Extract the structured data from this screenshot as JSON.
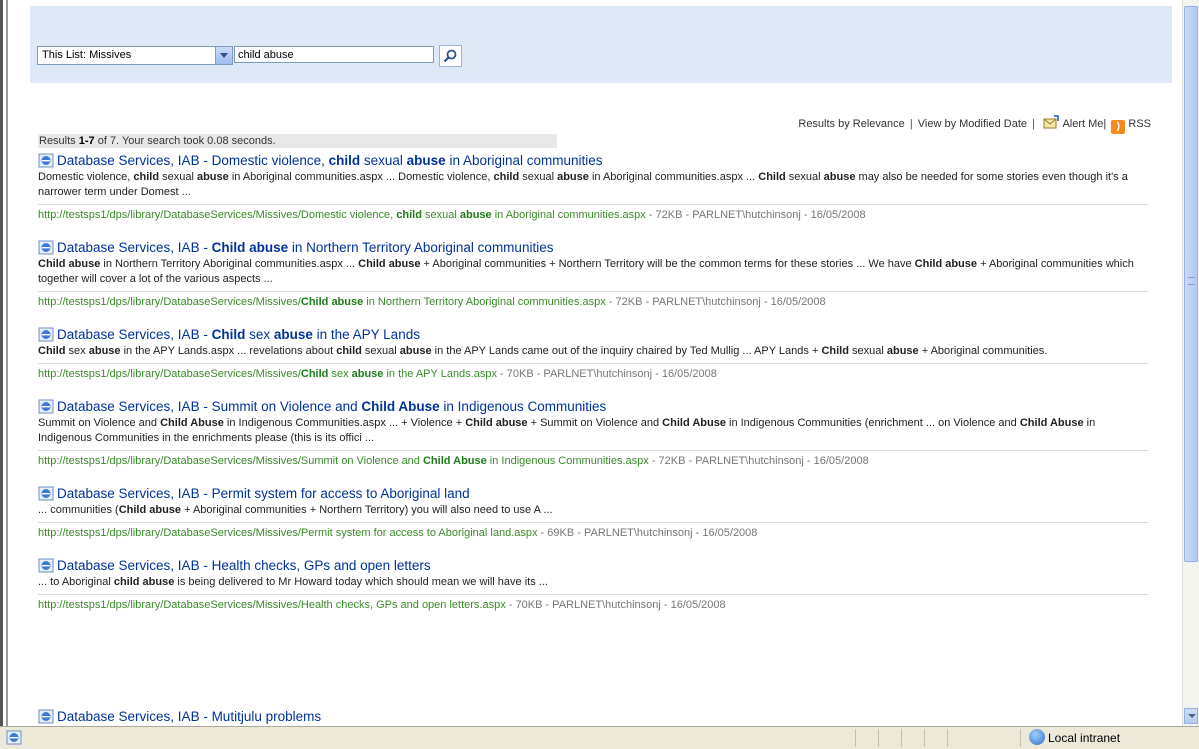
{
  "search": {
    "scope_label": "This List: Missives",
    "query": "child abuse"
  },
  "toolbar": {
    "by_relevance": "Results by Relevance",
    "separator": "|",
    "by_modified": "View by Modified Date",
    "alert_me": "Alert Me|",
    "rss": "RSS"
  },
  "stats": {
    "prefix": "Results ",
    "range": "1-7",
    "middle": " of 7. Your search took 0.08 seconds."
  },
  "results": [
    {
      "title_segments": [
        {
          "text": "Database Services, IAB - Domestic violence, ",
          "bold": false
        },
        {
          "text": "child",
          "bold": true
        },
        {
          "text": " sexual ",
          "bold": false
        },
        {
          "text": "abuse",
          "bold": true
        },
        {
          "text": " in Aboriginal communities",
          "bold": false
        }
      ],
      "snippet_segments": [
        {
          "text": "Domestic violence, ",
          "bold": false
        },
        {
          "text": "child",
          "bold": true
        },
        {
          "text": " sexual ",
          "bold": false
        },
        {
          "text": "abuse",
          "bold": true
        },
        {
          "text": " in Aboriginal communities.aspx ... Domestic violence, ",
          "bold": false
        },
        {
          "text": "child",
          "bold": true
        },
        {
          "text": " sexual ",
          "bold": false
        },
        {
          "text": "abuse",
          "bold": true
        },
        {
          "text": " in Aboriginal communities.aspx ... ",
          "bold": false
        },
        {
          "text": "Child",
          "bold": true
        },
        {
          "text": " sexual ",
          "bold": false
        },
        {
          "text": "abuse",
          "bold": true
        },
        {
          "text": " may also be needed for some stories even though it's a narrower term under Domest ...",
          "bold": false
        }
      ],
      "url_segments": [
        {
          "text": "http://testsps1/dps/library/DatabaseServices/Missives/Domestic violence, ",
          "bold": false
        },
        {
          "text": "child",
          "bold": true
        },
        {
          "text": " sexual ",
          "bold": false
        },
        {
          "text": "abuse",
          "bold": true
        },
        {
          "text": " in Aboriginal communities.aspx",
          "bold": false
        }
      ],
      "meta": " - 72KB - PARLNET\\hutchinsonj - 16/05/2008"
    },
    {
      "title_segments": [
        {
          "text": "Database Services, IAB - ",
          "bold": false
        },
        {
          "text": "Child abuse",
          "bold": true
        },
        {
          "text": " in Northern Territory Aboriginal communities",
          "bold": false
        }
      ],
      "snippet_segments": [
        {
          "text": "Child abuse",
          "bold": true
        },
        {
          "text": " in Northern Territory Aboriginal communities.aspx ... ",
          "bold": false
        },
        {
          "text": "Child abuse",
          "bold": true
        },
        {
          "text": " + Aboriginal communities + Northern Territory will be the common terms for these stories ... We have ",
          "bold": false
        },
        {
          "text": "Child abuse",
          "bold": true
        },
        {
          "text": " + Aboriginal communities which together will cover a lot of the various aspects ...",
          "bold": false
        }
      ],
      "url_segments": [
        {
          "text": "http://testsps1/dps/library/DatabaseServices/Missives/",
          "bold": false
        },
        {
          "text": "Child abuse",
          "bold": true
        },
        {
          "text": " in Northern Territory Aboriginal communities.aspx",
          "bold": false
        }
      ],
      "meta": " - 72KB - PARLNET\\hutchinsonj - 16/05/2008"
    },
    {
      "title_segments": [
        {
          "text": "Database Services, IAB - ",
          "bold": false
        },
        {
          "text": "Child",
          "bold": true
        },
        {
          "text": " sex ",
          "bold": false
        },
        {
          "text": "abuse",
          "bold": true
        },
        {
          "text": " in the APY Lands",
          "bold": false
        }
      ],
      "snippet_segments": [
        {
          "text": "Child",
          "bold": true
        },
        {
          "text": " sex ",
          "bold": false
        },
        {
          "text": "abuse",
          "bold": true
        },
        {
          "text": " in the APY Lands.aspx ... revelations about ",
          "bold": false
        },
        {
          "text": "child",
          "bold": true
        },
        {
          "text": " sexual ",
          "bold": false
        },
        {
          "text": "abuse",
          "bold": true
        },
        {
          "text": " in the APY Lands came out of the inquiry chaired by Ted Mullig ... APY Lands + ",
          "bold": false
        },
        {
          "text": "Child",
          "bold": true
        },
        {
          "text": " sexual ",
          "bold": false
        },
        {
          "text": "abuse",
          "bold": true
        },
        {
          "text": " + Aboriginal communities.",
          "bold": false
        }
      ],
      "url_segments": [
        {
          "text": "http://testsps1/dps/library/DatabaseServices/Missives/",
          "bold": false
        },
        {
          "text": "Child",
          "bold": true
        },
        {
          "text": " sex ",
          "bold": false
        },
        {
          "text": "abuse",
          "bold": true
        },
        {
          "text": " in the APY Lands.aspx",
          "bold": false
        }
      ],
      "meta": " - 70KB - PARLNET\\hutchinsonj - 16/05/2008"
    },
    {
      "title_segments": [
        {
          "text": "Database Services, IAB - Summit on Violence and ",
          "bold": false
        },
        {
          "text": "Child Abuse",
          "bold": true
        },
        {
          "text": " in Indigenous Communities",
          "bold": false
        }
      ],
      "snippet_segments": [
        {
          "text": "Summit on Violence and ",
          "bold": false
        },
        {
          "text": "Child Abuse",
          "bold": true
        },
        {
          "text": " in Indigenous Communities.aspx ... + Violence + ",
          "bold": false
        },
        {
          "text": "Child abuse",
          "bold": true
        },
        {
          "text": " + Summit on Violence and ",
          "bold": false
        },
        {
          "text": "Child Abuse",
          "bold": true
        },
        {
          "text": " in Indigenous Communities (enrichment ... on Violence and ",
          "bold": false
        },
        {
          "text": "Child Abuse",
          "bold": true
        },
        {
          "text": " in Indigenous Communities in the enrichments please (this is its offici ...",
          "bold": false
        }
      ],
      "url_segments": [
        {
          "text": "http://testsps1/dps/library/DatabaseServices/Missives/Summit on Violence and ",
          "bold": false
        },
        {
          "text": "Child Abuse",
          "bold": true
        },
        {
          "text": " in Indigenous Communities.aspx",
          "bold": false
        }
      ],
      "meta": " - 72KB - PARLNET\\hutchinsonj - 16/05/2008"
    },
    {
      "title_segments": [
        {
          "text": "Database Services, IAB - Permit system for access to Aboriginal land",
          "bold": false
        }
      ],
      "snippet_segments": [
        {
          "text": "... communities (",
          "bold": false
        },
        {
          "text": "Child abuse",
          "bold": true
        },
        {
          "text": " + Aboriginal communities + Northern Territory) you will also need to use A ...",
          "bold": false
        }
      ],
      "url_segments": [
        {
          "text": "http://testsps1/dps/library/DatabaseServices/Missives/Permit system for access to Aboriginal land.aspx",
          "bold": false
        }
      ],
      "meta": " - 69KB - PARLNET\\hutchinsonj - 16/05/2008"
    },
    {
      "title_segments": [
        {
          "text": "Database Services, IAB - Health checks, GPs and open letters",
          "bold": false
        }
      ],
      "snippet_segments": [
        {
          "text": "... to Aboriginal ",
          "bold": false
        },
        {
          "text": "child abuse",
          "bold": true
        },
        {
          "text": " is being delivered to Mr Howard today which should mean we will have its ...",
          "bold": false
        }
      ],
      "url_segments": [
        {
          "text": "http://testsps1/dps/library/DatabaseServices/Missives/Health checks, GPs and open letters.aspx",
          "bold": false
        }
      ],
      "meta": " - 70KB - PARLNET\\hutchinsonj - 16/05/2008"
    }
  ],
  "partial_result_title": "Database Services, IAB - Mutitjulu problems",
  "status": {
    "zone": "Local intranet"
  },
  "colors": {
    "panel": "#dfe8f7",
    "title_link": "#003399",
    "url": "#3a8a2a"
  },
  "icons": {
    "result": "ie-page-icon",
    "search": "search-icon",
    "alert": "alert-me-icon",
    "rss": "rss-icon",
    "zone": "intranet-globe-icon"
  }
}
